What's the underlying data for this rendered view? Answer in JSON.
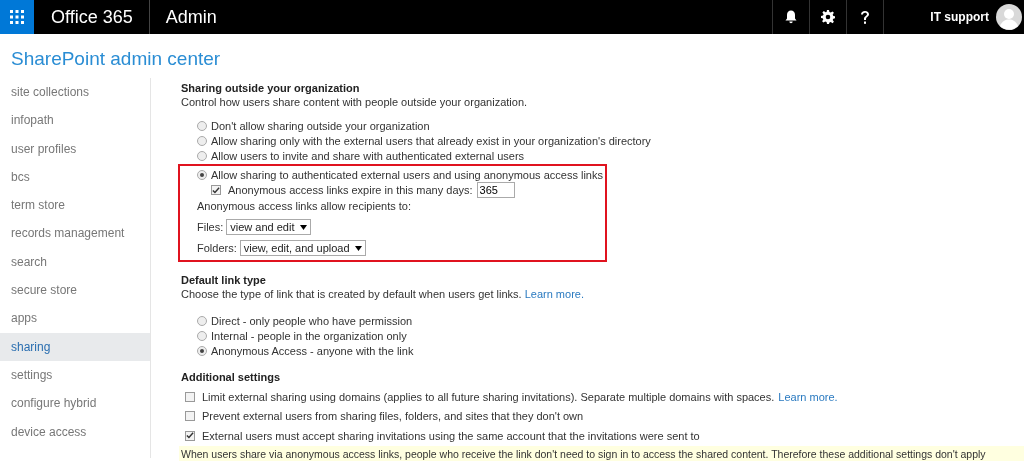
{
  "topbar": {
    "brand": "Office 365",
    "app": "Admin",
    "user": "IT support"
  },
  "page_title": "SharePoint admin center",
  "sidebar": {
    "items": [
      {
        "label": "site collections",
        "selected": false
      },
      {
        "label": "infopath",
        "selected": false
      },
      {
        "label": "user profiles",
        "selected": false
      },
      {
        "label": "bcs",
        "selected": false
      },
      {
        "label": "term store",
        "selected": false
      },
      {
        "label": "records management",
        "selected": false
      },
      {
        "label": "search",
        "selected": false
      },
      {
        "label": "secure store",
        "selected": false
      },
      {
        "label": "apps",
        "selected": false
      },
      {
        "label": "sharing",
        "selected": true
      },
      {
        "label": "settings",
        "selected": false
      },
      {
        "label": "configure hybrid",
        "selected": false
      },
      {
        "label": "device access",
        "selected": false
      }
    ]
  },
  "sharing_outside": {
    "title": "Sharing outside your organization",
    "description": "Control how users share content with people outside your organization.",
    "options": [
      {
        "label": "Don't allow sharing outside your organization",
        "selected": false,
        "highlighted": false
      },
      {
        "label": "Allow sharing only with the external users that already exist in your organization's directory",
        "selected": false,
        "highlighted": false
      },
      {
        "label": "Allow users to invite and share with authenticated external users",
        "selected": false,
        "highlighted": false
      },
      {
        "label": "Allow sharing to authenticated external users and using anonymous access links",
        "selected": true,
        "highlighted": true
      }
    ],
    "expire": {
      "label": "Anonymous access links expire in this many days:",
      "checked": true,
      "value": "365"
    },
    "recipients_label": "Anonymous access links allow recipients to:",
    "dropdowns": [
      {
        "label": "Files:",
        "value": "view and edit"
      },
      {
        "label": "Folders:",
        "value": "view, edit, and upload"
      }
    ]
  },
  "default_link": {
    "title": "Default link type",
    "description": "Choose the type of link that is created by default when users get links.",
    "link": "Learn more.",
    "options": [
      {
        "label": "Direct - only people who have permission",
        "selected": false
      },
      {
        "label": "Internal - people in the organization only",
        "selected": false
      },
      {
        "label": "Anonymous Access - anyone with the link",
        "selected": true
      }
    ]
  },
  "additional": {
    "title": "Additional settings",
    "items": [
      {
        "label": "Limit external sharing using domains (applies to all future sharing invitations). Separate multiple domains with spaces.",
        "link": "Learn more.",
        "checked": false
      },
      {
        "label": "Prevent external users from sharing files, folders, and sites that they don't own",
        "checked": false
      },
      {
        "label": "External users must accept sharing invitations using the same account that the invitations were sent to",
        "checked": true
      }
    ],
    "note": "When users share via anonymous access links, people who receive the link don't need to sign in to access the shared content. Therefore these additional settings don't apply"
  }
}
